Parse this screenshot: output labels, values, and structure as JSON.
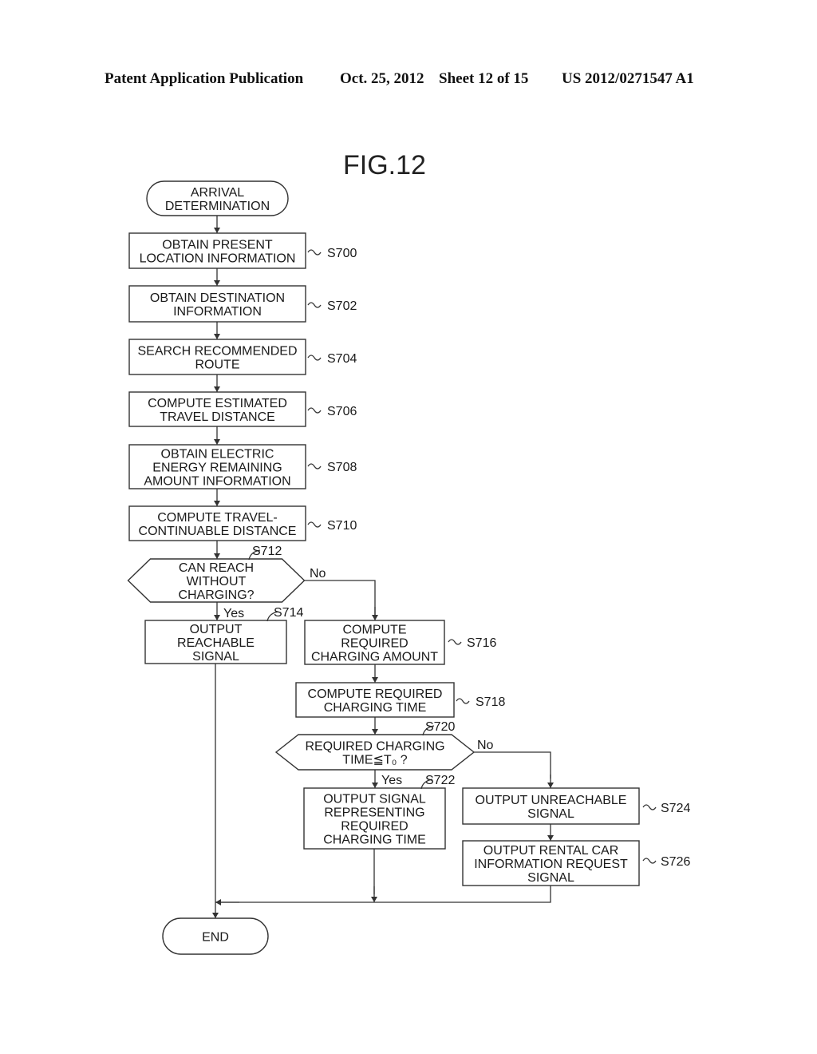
{
  "header": {
    "publication": "Patent Application Publication",
    "date": "Oct. 25, 2012",
    "sheet": "Sheet 12 of 15",
    "number": "US 2012/0271547 A1"
  },
  "figure": {
    "title": "FIG.12"
  },
  "flowchart": {
    "start": {
      "lines": [
        "ARRIVAL",
        "DETERMINATION"
      ]
    },
    "end": {
      "lines": [
        "END"
      ]
    },
    "steps": [
      {
        "id": "S700",
        "lines": [
          "OBTAIN PRESENT",
          "LOCATION INFORMATION"
        ]
      },
      {
        "id": "S702",
        "lines": [
          "OBTAIN DESTINATION",
          "INFORMATION"
        ]
      },
      {
        "id": "S704",
        "lines": [
          "SEARCH RECOMMENDED",
          "ROUTE"
        ]
      },
      {
        "id": "S706",
        "lines": [
          "COMPUTE ESTIMATED",
          "TRAVEL DISTANCE"
        ]
      },
      {
        "id": "S708",
        "lines": [
          "OBTAIN ELECTRIC",
          "ENERGY REMAINING",
          "AMOUNT INFORMATION"
        ]
      },
      {
        "id": "S710",
        "lines": [
          "COMPUTE TRAVEL-",
          "CONTINUABLE DISTANCE"
        ]
      },
      {
        "id": "S712",
        "type": "decision",
        "lines": [
          "CAN REACH",
          "WITHOUT",
          "CHARGING?"
        ]
      },
      {
        "id": "S714",
        "lines": [
          "OUTPUT",
          "REACHABLE",
          "SIGNAL"
        ]
      },
      {
        "id": "S716",
        "lines": [
          "COMPUTE",
          "REQUIRED",
          "CHARGING AMOUNT"
        ]
      },
      {
        "id": "S718",
        "lines": [
          "COMPUTE REQUIRED",
          "CHARGING TIME"
        ]
      },
      {
        "id": "S720",
        "type": "decision",
        "lines": [
          "REQUIRED CHARGING",
          "TIME≦T₀ ?"
        ]
      },
      {
        "id": "S722",
        "lines": [
          "OUTPUT SIGNAL",
          "REPRESENTING",
          "REQUIRED",
          "CHARGING TIME"
        ]
      },
      {
        "id": "S724",
        "lines": [
          "OUTPUT UNREACHABLE",
          "SIGNAL"
        ]
      },
      {
        "id": "S726",
        "lines": [
          "OUTPUT RENTAL CAR",
          "INFORMATION REQUEST",
          "SIGNAL"
        ]
      }
    ],
    "branches": {
      "yes": "Yes",
      "no": "No"
    }
  }
}
